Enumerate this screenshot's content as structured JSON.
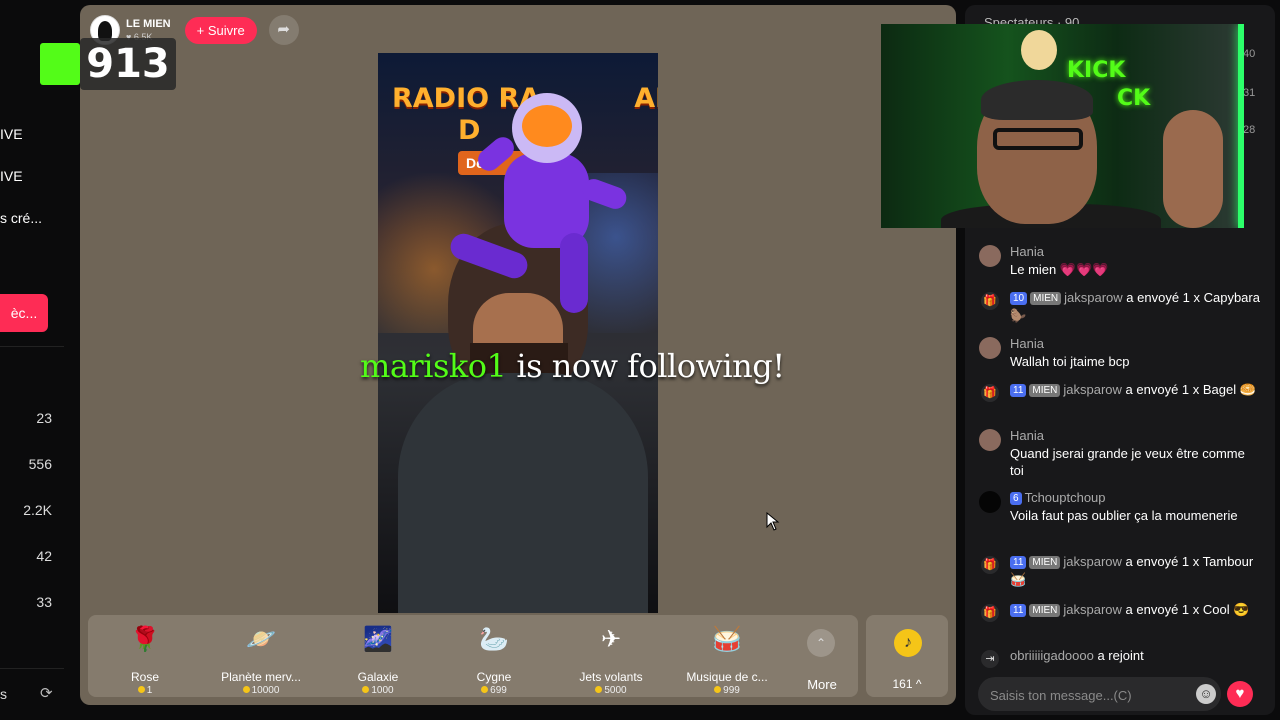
{
  "overlay": {
    "viewer_count": "913"
  },
  "sidebar": {
    "nav_items": [
      "IVE",
      "IVE",
      "s cré..."
    ],
    "action_button": "èc...",
    "counts": [
      "23",
      "556",
      "2.2K",
      "42",
      "33"
    ],
    "bottom_text": "s"
  },
  "streamer": {
    "name": "LE MIEN",
    "likes": "6.5K",
    "follow_label": "+ Suivre"
  },
  "stream_overlay": {
    "banner_line1": "RADIO RA",
    "banner_line1b": "ALE",
    "banner_line2": "D",
    "banner_sub": "De",
    "follow_user": "marisko1",
    "follow_text": "is now following!"
  },
  "gifts": [
    {
      "name": "Rose",
      "price": "1",
      "icon": "rose-icon",
      "glyph": "🌹"
    },
    {
      "name": "Planète merv...",
      "price": "10000",
      "icon": "planet-icon",
      "glyph": "🪐"
    },
    {
      "name": "Galaxie",
      "price": "1000",
      "icon": "galaxy-icon",
      "glyph": "🌌"
    },
    {
      "name": "Cygne",
      "price": "699",
      "icon": "swan-icon",
      "glyph": "🦢"
    },
    {
      "name": "Jets volants",
      "price": "5000",
      "icon": "jets-icon",
      "glyph": "✈"
    },
    {
      "name": "Musique de c...",
      "price": "999",
      "icon": "music-icon",
      "glyph": "🥁"
    }
  ],
  "gift_bar": {
    "more_label": "More",
    "coins": "161",
    "coin_caret": "^"
  },
  "chat": {
    "header": "Spectateurs · 90",
    "side_numbers": [
      "40",
      "31",
      "28"
    ],
    "messages": [
      {
        "type": "text",
        "user": "Hania",
        "text": "Le mien 💗💗💗"
      },
      {
        "type": "gift",
        "level": "10",
        "fan": "MIEN",
        "user": "jaksparow",
        "text": "a envoyé 1 x Capybara 🦫"
      },
      {
        "type": "text",
        "user": "Hania",
        "text": "Wallah toi jtaime bcp"
      },
      {
        "type": "gift",
        "level": "11",
        "fan": "MIEN",
        "user": "jaksparow",
        "text": "a envoyé 1 x Bagel 🥯"
      },
      {
        "type": "text",
        "user": "Hania",
        "text": "Quand jserai grande je veux être comme toi"
      },
      {
        "type": "badge",
        "level": "6",
        "user": "Tchouptchoup",
        "text": "Voila faut pas oublier ça la moumenerie"
      },
      {
        "type": "gift",
        "level": "11",
        "fan": "MIEN",
        "user": "jaksparow",
        "text": "a envoyé 1 x Tambour 🥁"
      },
      {
        "type": "gift",
        "level": "11",
        "fan": "MIEN",
        "user": "jaksparow",
        "text": "a envoyé 1 x Cool 😎"
      },
      {
        "type": "join",
        "user": "obriiiiigadoooo",
        "text": "a rejoint"
      }
    ],
    "input_placeholder": "Saisis ton message...(C)"
  },
  "colors": {
    "accent": "#fe2c55",
    "kick_green": "#53fc18",
    "player_bg": "#6f6557"
  }
}
